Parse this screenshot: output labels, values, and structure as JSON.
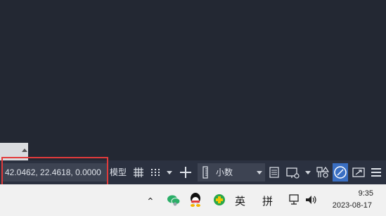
{
  "statusbar": {
    "coordinates": "42.0462, 22.4618, 0.0000",
    "model_label": "模型",
    "units_label": "小数",
    "clean_screen_active": true
  },
  "taskbar": {
    "ime_english": "英",
    "ime_pinyin": "拼",
    "time": "9:35",
    "date": "2023-08-17"
  },
  "icons": {
    "grid": "grid-icon",
    "snap": "snap-dots-icon",
    "crosshair": "crosshair-icon",
    "ruler": "ruler-icon",
    "properties": "properties-list-icon",
    "workspace": "workspace-screen-icon",
    "annotation": "annotation-shapes-icon",
    "clean_screen": "clean-screen-icon",
    "fullscreen": "fullscreen-icon",
    "menu": "hamburger-menu-icon",
    "wechat": "wechat-icon",
    "qq": "qq-icon",
    "app": "green-app-icon",
    "network": "network-icon",
    "volume": "speaker-icon"
  },
  "colors": {
    "canvas_bg": "#232833",
    "statusbar_bg": "#2b3140",
    "active_blue": "#3a6fc3",
    "highlight_red": "#e23b3b"
  }
}
